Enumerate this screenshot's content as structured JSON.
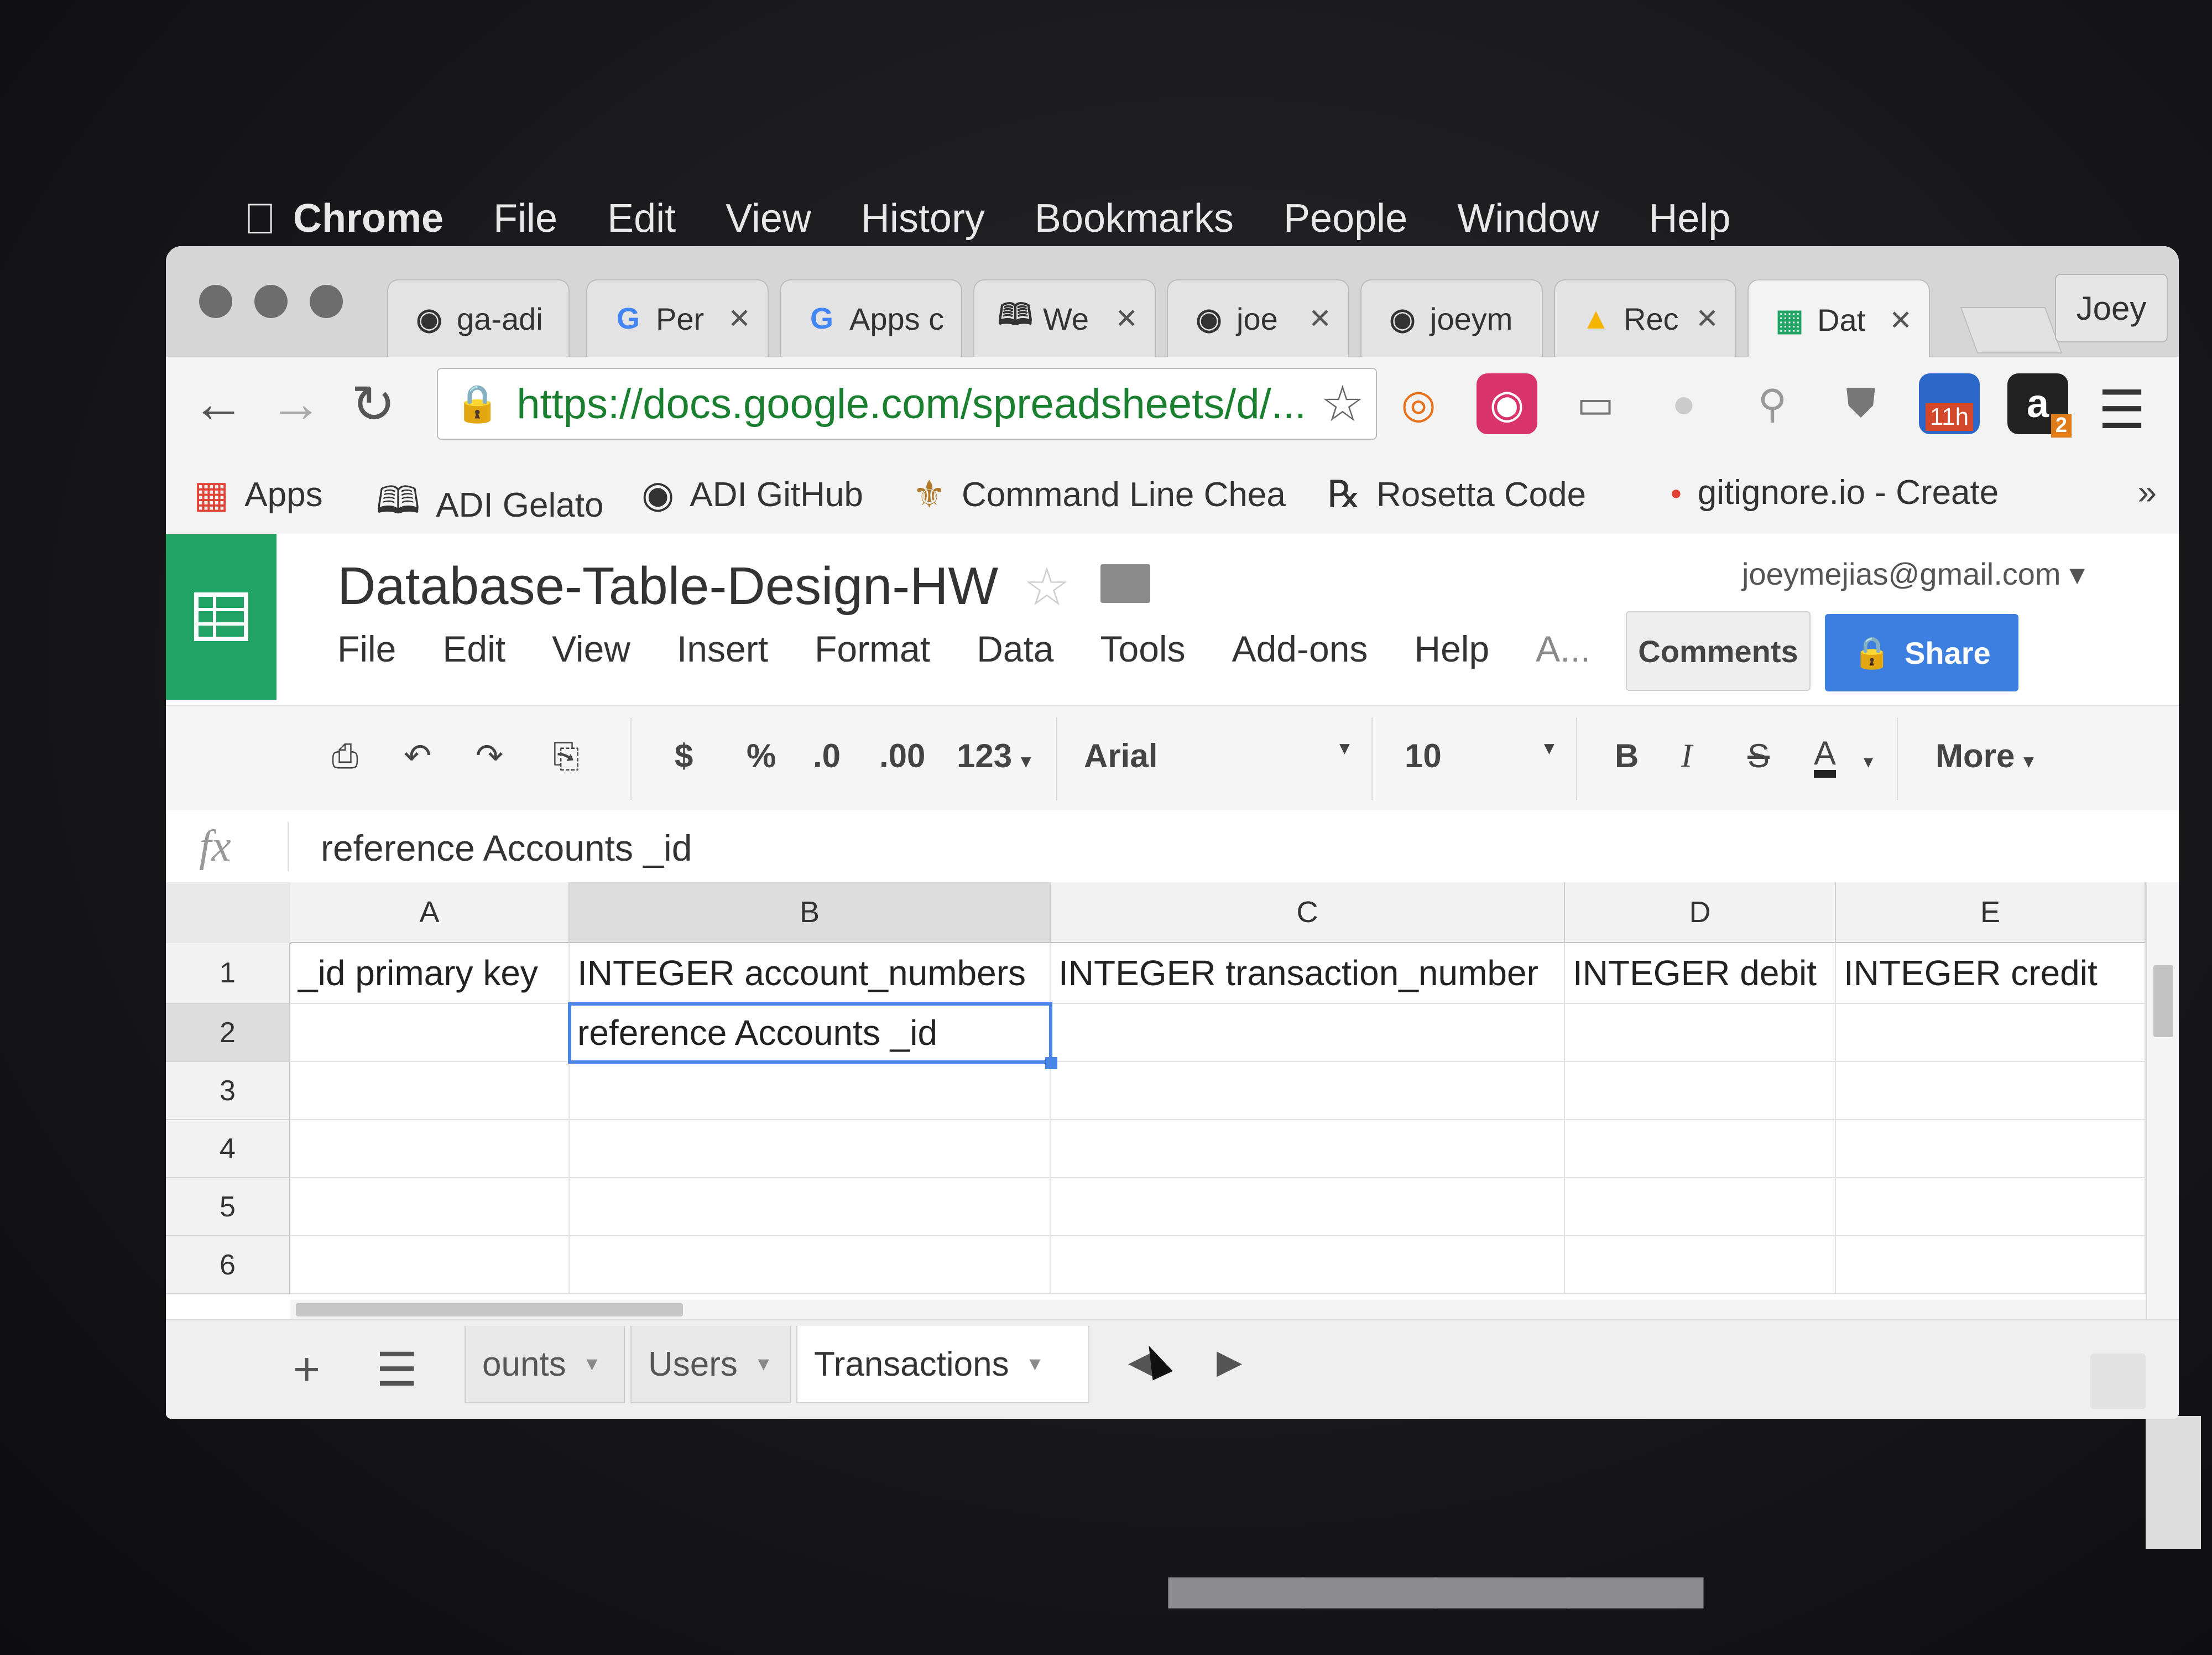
{
  "mac_menubar": {
    "app_name": "Chrome",
    "items": [
      "File",
      "Edit",
      "View",
      "History",
      "Bookmarks",
      "People",
      "Window",
      "Help"
    ]
  },
  "browser": {
    "tabs": [
      {
        "icon": "github-icon",
        "title": "ga-adi"
      },
      {
        "icon": "google-icon",
        "title": "Per"
      },
      {
        "icon": "google-icon",
        "title": "Apps c"
      },
      {
        "icon": "book-icon",
        "title": "We"
      },
      {
        "icon": "github-icon",
        "title": "joe"
      },
      {
        "icon": "github-icon",
        "title": "joeym"
      },
      {
        "icon": "drive-icon",
        "title": "Rec"
      },
      {
        "icon": "sheets-icon",
        "title": "Dat"
      }
    ],
    "profile_name": "Joey",
    "url": "https://docs.google.com/spreadsheets/d/...",
    "extension_badges": {
      "timer": "11h",
      "amazon": "2"
    },
    "bookmarks": [
      {
        "icon": "apps-grid-icon",
        "label": "Apps"
      },
      {
        "icon": "book-icon",
        "label": "ADI Gelato"
      },
      {
        "icon": "github-icon",
        "label": "ADI GitHub"
      },
      {
        "icon": "lamp-icon",
        "label": "Command Line Chea"
      },
      {
        "icon": "rosetta-icon",
        "label": "Rosetta Code"
      },
      {
        "icon": "dot-icon",
        "label": "gitignore.io - Create"
      }
    ],
    "bookmarks_overflow": "»"
  },
  "sheet": {
    "doc_title": "Database-Table-Design-HW",
    "account_email": "joeymejias@gmail.com",
    "menu": [
      "File",
      "Edit",
      "View",
      "Insert",
      "Format",
      "Data",
      "Tools",
      "Add-ons",
      "Help",
      "A..."
    ],
    "comments_label": "Comments",
    "share_label": "Share",
    "toolbar": {
      "currency": "$",
      "percent": "%",
      "decrease_decimal": ".0",
      "increase_decimal": ".00",
      "number_format": "123",
      "font": "Arial",
      "font_size": "10",
      "bold": "B",
      "italic": "I",
      "strikethrough": "S",
      "text_color": "A",
      "more": "More"
    },
    "formula_value": "reference Accounts _id",
    "columns": [
      "A",
      "B",
      "C",
      "D",
      "E"
    ],
    "rows": [
      "1",
      "2",
      "3",
      "4",
      "5",
      "6"
    ],
    "cells": {
      "A1": "_id primary key",
      "B1": "INTEGER account_numbers",
      "C1": "INTEGER transaction_number",
      "D1": "INTEGER debit",
      "E1": "INTEGER credit",
      "B2": "reference Accounts _id"
    },
    "active_cell": "B2",
    "sheet_tabs": [
      "ounts",
      "Users",
      "Transactions"
    ],
    "active_sheet": "Transactions"
  },
  "colors": {
    "sheets_green": "#21a366",
    "share_blue": "#3d7fe0",
    "selection_blue": "#4a86e8"
  }
}
